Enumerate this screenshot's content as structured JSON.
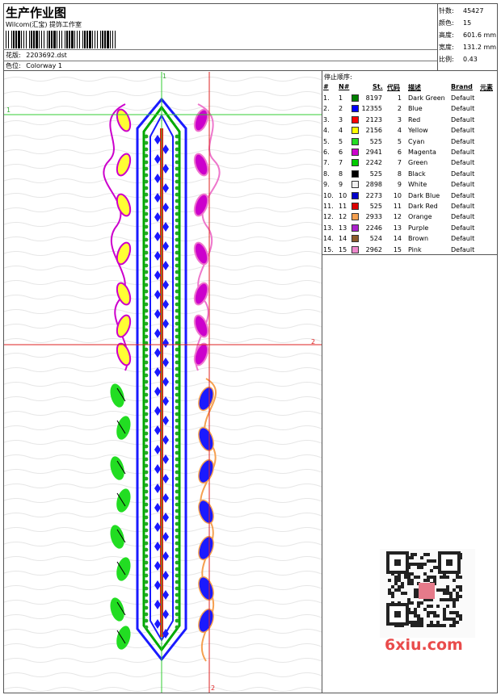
{
  "header": {
    "title": "生产作业图",
    "company": "Wilcom(汇宝) 提饰工作室",
    "design_label": "花版:",
    "design_value": "2203692.dst",
    "colorway_label": "色位:",
    "colorway_value": "Colorway 1"
  },
  "stats": [
    {
      "label": "针数:",
      "value": "45427"
    },
    {
      "label": "颜色:",
      "value": "15"
    },
    {
      "label": "高度:",
      "value": "601.6 mm"
    },
    {
      "label": "宽度:",
      "value": "131.2 mm"
    },
    {
      "label": "比例:",
      "value": "0.43"
    }
  ],
  "legend": {
    "title": "停止顺序:",
    "headers": {
      "num": "#",
      "n": "N#",
      "st": "St.",
      "code": "代码",
      "desc": "描述",
      "brand": "Brand",
      "elem": "元素"
    },
    "rows": [
      {
        "num": "1.",
        "n": "1",
        "st": "8197",
        "code": "1",
        "desc": "Dark Green",
        "brand": "Default",
        "color": "#008000"
      },
      {
        "num": "2.",
        "n": "2",
        "st": "12355",
        "code": "2",
        "desc": "Blue",
        "brand": "Default",
        "color": "#0000ff"
      },
      {
        "num": "3.",
        "n": "3",
        "st": "2123",
        "code": "3",
        "desc": "Red",
        "brand": "Default",
        "color": "#ff0000"
      },
      {
        "num": "4.",
        "n": "4",
        "st": "2156",
        "code": "4",
        "desc": "Yellow",
        "brand": "Default",
        "color": "#ffff00"
      },
      {
        "num": "5.",
        "n": "5",
        "st": "525",
        "code": "5",
        "desc": "Cyan",
        "brand": "Default",
        "color": "#22dd22"
      },
      {
        "num": "6.",
        "n": "6",
        "st": "2941",
        "code": "6",
        "desc": "Magenta",
        "brand": "Default",
        "color": "#cc00cc"
      },
      {
        "num": "7.",
        "n": "7",
        "st": "2242",
        "code": "7",
        "desc": "Green",
        "brand": "Default",
        "color": "#00cc00"
      },
      {
        "num": "8.",
        "n": "8",
        "st": "525",
        "code": "8",
        "desc": "Black",
        "brand": "Default",
        "color": "#000000"
      },
      {
        "num": "9.",
        "n": "9",
        "st": "2898",
        "code": "9",
        "desc": "White",
        "brand": "Default",
        "color": "#f0f0f0"
      },
      {
        "num": "10.",
        "n": "10",
        "st": "2273",
        "code": "10",
        "desc": "Dark Blue",
        "brand": "Default",
        "color": "#0000cc"
      },
      {
        "num": "11.",
        "n": "11",
        "st": "525",
        "code": "11",
        "desc": "Dark Red",
        "brand": "Default",
        "color": "#dd0000"
      },
      {
        "num": "12.",
        "n": "12",
        "st": "2933",
        "code": "12",
        "desc": "Orange",
        "brand": "Default",
        "color": "#f5a050"
      },
      {
        "num": "13.",
        "n": "13",
        "st": "2246",
        "code": "13",
        "desc": "Purple",
        "brand": "Default",
        "color": "#aa22cc"
      },
      {
        "num": "14.",
        "n": "14",
        "st": "524",
        "code": "14",
        "desc": "Brown",
        "brand": "Default",
        "color": "#8b5a2b"
      },
      {
        "num": "15.",
        "n": "15",
        "st": "2962",
        "code": "15",
        "desc": "Pink",
        "brand": "Default",
        "color": "#ee88cc"
      }
    ]
  },
  "guides": {
    "h1": "1",
    "v1": "1",
    "h2": "2",
    "v2": "2"
  },
  "watermark": "6xiu.com"
}
